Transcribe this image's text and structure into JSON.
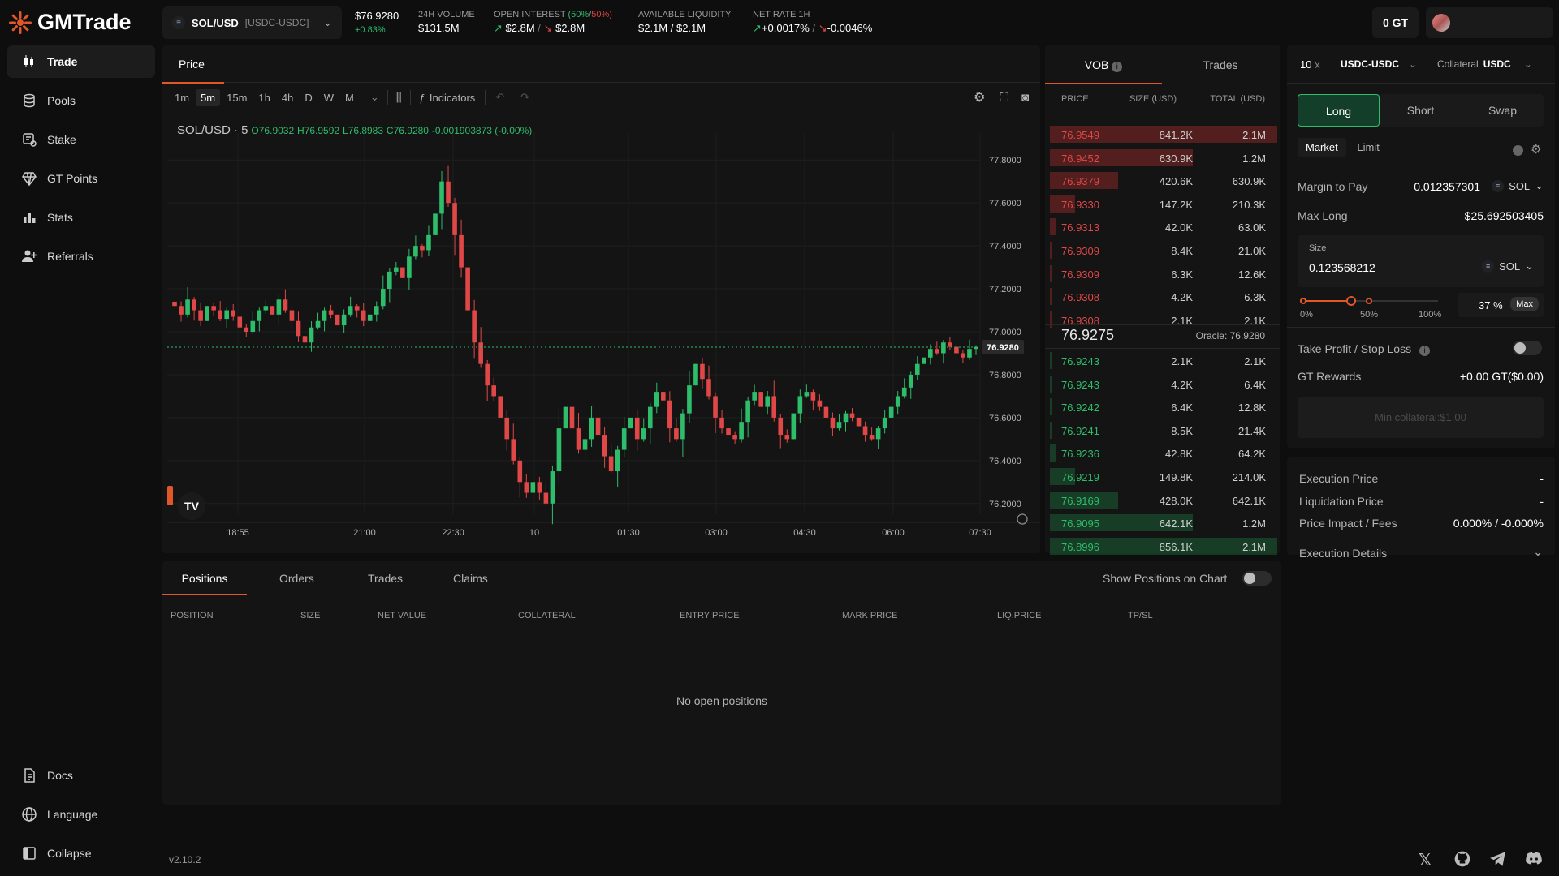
{
  "app": {
    "name": "GMTrade",
    "version": "v2.10.2"
  },
  "header": {
    "pair": "SOL/USD",
    "pair_sub": "[USDC-USDC]",
    "price": "$76.9280",
    "change": "+0.83%",
    "volume_label": "24H VOLUME",
    "volume": "$131.5M",
    "oi_label": "OPEN INTEREST",
    "oi_long_pct": "(50%",
    "oi_sep": "/",
    "oi_short_pct": "50%)",
    "oi_long": "$2.8M",
    "oi_short": "$2.8M",
    "liq_label": "AVAILABLE LIQUIDITY",
    "liq": "$2.1M / $2.1M",
    "rate_label": "NET RATE 1H",
    "rate_long": "+0.0017%",
    "rate_short": "-0.0046%",
    "gt": "0 GT"
  },
  "sidebar": {
    "items": [
      {
        "label": "Trade",
        "icon": "candles-icon"
      },
      {
        "label": "Pools",
        "icon": "database-icon"
      },
      {
        "label": "Stake",
        "icon": "stake-icon"
      },
      {
        "label": "GT Points",
        "icon": "diamond-icon"
      },
      {
        "label": "Stats",
        "icon": "bar-chart-icon"
      },
      {
        "label": "Referrals",
        "icon": "user-add-icon"
      }
    ],
    "bottom": [
      {
        "label": "Docs",
        "icon": "document-icon"
      },
      {
        "label": "Language",
        "icon": "globe-icon"
      },
      {
        "label": "Collapse",
        "icon": "collapse-icon"
      }
    ]
  },
  "chart": {
    "tab": "Price",
    "timeframes": [
      "1m",
      "5m",
      "15m",
      "1h",
      "4h",
      "D",
      "W",
      "M"
    ],
    "active_tf": "5m",
    "indicators_label": "Indicators",
    "symbol": "SOL/USD · 5",
    "o": "O76.9032",
    "h": "H76.9592",
    "l": "L76.8983",
    "c": "C76.9280",
    "chg": "-0.001903873 (-0.00%)",
    "last_price": "76.9280"
  },
  "chart_data": {
    "type": "candlestick",
    "yticks": [
      "77.8000",
      "77.6000",
      "77.4000",
      "77.2000",
      "77.0000",
      "76.8000",
      "76.6000",
      "76.4000",
      "76.2000"
    ],
    "xticks": [
      "18:55",
      "21:00",
      "22:30",
      "10",
      "01:30",
      "03:00",
      "04:30",
      "06:00",
      "07:30"
    ],
    "ylim": [
      76.15,
      77.85
    ],
    "close": [
      77.12,
      77.08,
      77.15,
      77.1,
      77.05,
      77.12,
      77.1,
      77.06,
      77.1,
      77.07,
      77.02,
      77.0,
      77.05,
      77.1,
      77.12,
      77.08,
      77.15,
      77.1,
      77.05,
      76.98,
      76.95,
      77.02,
      77.05,
      77.1,
      77.08,
      77.03,
      77.08,
      77.12,
      77.1,
      77.05,
      77.08,
      77.12,
      77.2,
      77.28,
      77.3,
      77.25,
      77.35,
      77.4,
      77.38,
      77.45,
      77.55,
      77.7,
      77.6,
      77.45,
      77.3,
      77.1,
      76.95,
      76.85,
      76.75,
      76.7,
      76.6,
      76.5,
      76.4,
      76.3,
      76.25,
      76.3,
      76.25,
      76.2,
      76.35,
      76.55,
      76.65,
      76.55,
      76.45,
      76.5,
      76.6,
      76.52,
      76.42,
      76.35,
      76.45,
      76.55,
      76.6,
      76.5,
      76.55,
      76.65,
      76.72,
      76.68,
      76.55,
      76.5,
      76.62,
      76.75,
      76.85,
      76.78,
      76.7,
      76.6,
      76.55,
      76.52,
      76.5,
      76.58,
      76.68,
      76.72,
      76.65,
      76.7,
      76.6,
      76.52,
      76.5,
      76.62,
      76.7,
      76.72,
      76.68,
      76.65,
      76.6,
      76.55,
      76.58,
      76.62,
      76.6,
      76.56,
      76.52,
      76.5,
      76.55,
      76.6,
      76.65,
      76.7,
      76.74,
      76.8,
      76.85,
      76.88,
      76.92,
      76.9,
      76.95,
      76.93,
      76.9,
      76.88,
      76.92,
      76.93
    ],
    "last": 76.928
  },
  "orderbook": {
    "tabs": [
      "VOB",
      "Trades"
    ],
    "headers": [
      "PRICE",
      "SIZE (USD)",
      "TOTAL (USD)"
    ],
    "asks": [
      {
        "p": "76.9549",
        "s": "841.2K",
        "t": "2.1M",
        "d": 1.0
      },
      {
        "p": "76.9452",
        "s": "630.9K",
        "t": "1.2M",
        "d": 0.63
      },
      {
        "p": "76.9379",
        "s": "420.6K",
        "t": "630.9K",
        "d": 0.3
      },
      {
        "p": "76.9330",
        "s": "147.2K",
        "t": "210.3K",
        "d": 0.11
      },
      {
        "p": "76.9313",
        "s": "42.0K",
        "t": "63.0K",
        "d": 0.03
      },
      {
        "p": "76.9309",
        "s": "8.4K",
        "t": "21.0K",
        "d": 0.01
      },
      {
        "p": "76.9309",
        "s": "6.3K",
        "t": "12.6K",
        "d": 0.01
      },
      {
        "p": "76.9308",
        "s": "4.2K",
        "t": "6.3K",
        "d": 0.01
      },
      {
        "p": "76.9308",
        "s": "2.1K",
        "t": "2.1K",
        "d": 0.01
      }
    ],
    "mid": "76.9275",
    "oracle": "Oracle: 76.9280",
    "bids": [
      {
        "p": "76.9243",
        "s": "2.1K",
        "t": "2.1K",
        "d": 0.01
      },
      {
        "p": "76.9243",
        "s": "4.2K",
        "t": "6.4K",
        "d": 0.01
      },
      {
        "p": "76.9242",
        "s": "6.4K",
        "t": "12.8K",
        "d": 0.01
      },
      {
        "p": "76.9241",
        "s": "8.5K",
        "t": "21.4K",
        "d": 0.01
      },
      {
        "p": "76.9236",
        "s": "42.8K",
        "t": "64.2K",
        "d": 0.03
      },
      {
        "p": "76.9219",
        "s": "149.8K",
        "t": "214.0K",
        "d": 0.11
      },
      {
        "p": "76.9169",
        "s": "428.0K",
        "t": "642.1K",
        "d": 0.3
      },
      {
        "p": "76.9095",
        "s": "642.1K",
        "t": "1.2M",
        "d": 0.63
      },
      {
        "p": "76.8996",
        "s": "856.1K",
        "t": "2.1M",
        "d": 1.0
      }
    ]
  },
  "order": {
    "leverage": "10",
    "leverage_x": "x",
    "market": "USDC-USDC",
    "collateral_label": "Collateral",
    "collateral": "USDC",
    "sides": [
      "Long",
      "Short",
      "Swap"
    ],
    "types": [
      "Market",
      "Limit"
    ],
    "margin_label": "Margin to Pay",
    "margin_value": "0.012357301",
    "margin_token": "SOL",
    "max_label": "Max Long",
    "max_value": "$25.692503405",
    "size_label": "Size",
    "size_value": "0.123568212",
    "size_token": "SOL",
    "slider_pct": 37,
    "slider_marks": [
      "0%",
      "50%",
      "100%"
    ],
    "pct_text": "37 %",
    "max_btn": "Max",
    "tpsl_label": "Take Profit / Stop Loss",
    "gt_rewards_label": "GT Rewards",
    "gt_rewards_value": "+0.00 GT($0.00)",
    "submit": "Min collateral:$1.00"
  },
  "info": {
    "exec_label": "Execution Price",
    "exec_value": "-",
    "liq_label": "Liquidation Price",
    "liq_value": "-",
    "impact_label": "Price Impact / Fees",
    "impact_value": "0.000% / -0.000%",
    "details_label": "Execution Details"
  },
  "positions": {
    "tabs": [
      "Positions",
      "Orders",
      "Trades",
      "Claims"
    ],
    "show_label": "Show Positions on Chart",
    "columns": [
      "POSITION",
      "SIZE",
      "NET VALUE",
      "COLLATERAL",
      "ENTRY PRICE",
      "MARK PRICE",
      "LIQ.PRICE",
      "TP/SL"
    ],
    "empty": "No open positions"
  },
  "colors": {
    "green": "#2ebd6b",
    "red": "#e04747",
    "accent": "#e0572a"
  }
}
